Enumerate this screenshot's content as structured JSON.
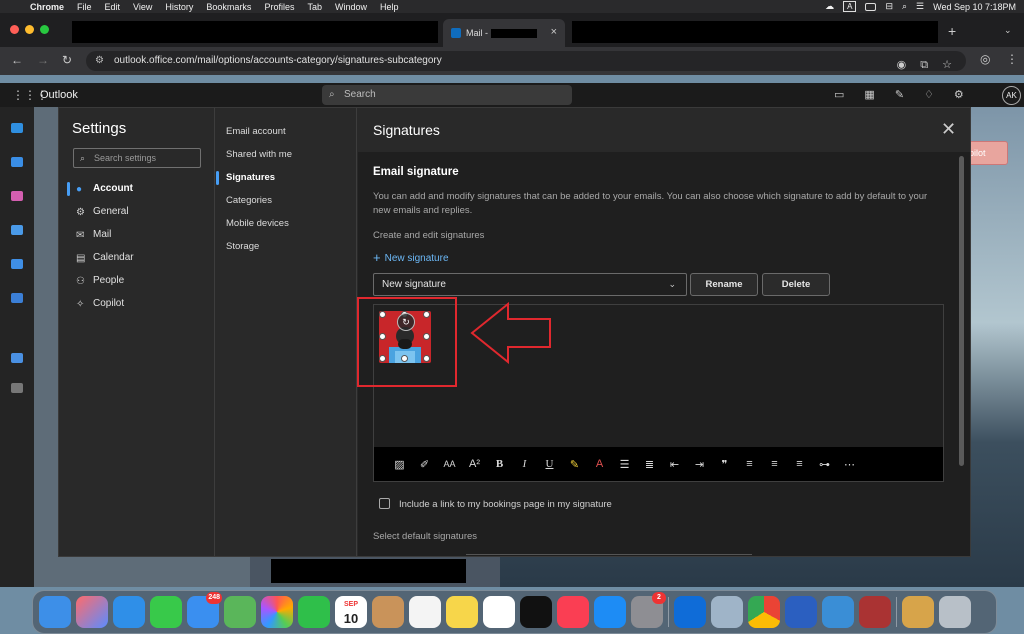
{
  "menubar": {
    "app_name": "Chrome",
    "items": [
      "File",
      "Edit",
      "View",
      "History",
      "Bookmarks",
      "Profiles",
      "Tab",
      "Window",
      "Help"
    ],
    "datetime": "Wed Sep 10  7:18PM",
    "input_indicator": "A"
  },
  "browser": {
    "active_tab_title": "Mail -",
    "url": "outlook.office.com/mail/options/accounts-category/signatures-subcategory",
    "tab_close": "×",
    "new_tab": "+"
  },
  "outlook": {
    "brand": "Outlook",
    "search_placeholder": "Search",
    "avatar_initials": "AK",
    "copilot_label": "pilot"
  },
  "settings": {
    "title": "Settings",
    "search_placeholder": "Search settings",
    "categories": [
      {
        "label": "Account",
        "icon": "person-icon",
        "active": true
      },
      {
        "label": "General",
        "icon": "gear-icon",
        "active": false
      },
      {
        "label": "Mail",
        "icon": "envelope-icon",
        "active": false
      },
      {
        "label": "Calendar",
        "icon": "calendar-icon",
        "active": false
      },
      {
        "label": "People",
        "icon": "people-icon",
        "active": false
      },
      {
        "label": "Copilot",
        "icon": "copilot-icon",
        "active": false
      }
    ],
    "subcategories": [
      {
        "label": "Email account",
        "active": false
      },
      {
        "label": "Shared with me",
        "active": false
      },
      {
        "label": "Signatures",
        "active": true
      },
      {
        "label": "Categories",
        "active": false
      },
      {
        "label": "Mobile devices",
        "active": false
      },
      {
        "label": "Storage",
        "active": false
      }
    ]
  },
  "signatures": {
    "page_title": "Signatures",
    "section_title": "Email signature",
    "description": "You can add and modify signatures that can be added to your emails. You can also choose which signature to add by default to your new emails and replies.",
    "create_edit_label": "Create and edit signatures",
    "new_signature_link": "New signature",
    "selected_signature": "New signature",
    "rename_button": "Rename",
    "delete_button": "Delete",
    "bookings_checkbox_label": "Include a link to my bookings page in my signature",
    "bookings_checked": false,
    "select_default_label": "Select default signatures"
  },
  "editor_toolbar": [
    "image-icon",
    "format-painter-icon",
    "font-size-icon",
    "superscript-icon",
    "bold-icon",
    "italic-icon",
    "underline-icon",
    "highlight-icon",
    "font-color-icon",
    "bullets-icon",
    "numbering-icon",
    "decrease-indent-icon",
    "increase-indent-icon",
    "quote-icon",
    "align-left-icon",
    "align-center-icon",
    "align-right-icon",
    "link-icon",
    "more-icon"
  ],
  "dock": {
    "mail_badge": "248",
    "settings_badge": "2",
    "calendar_month": "SEP",
    "calendar_day": "10"
  },
  "colors": {
    "accent": "#479ef5",
    "annotation_red": "#e0282e",
    "link_blue": "#6cb8f6"
  }
}
